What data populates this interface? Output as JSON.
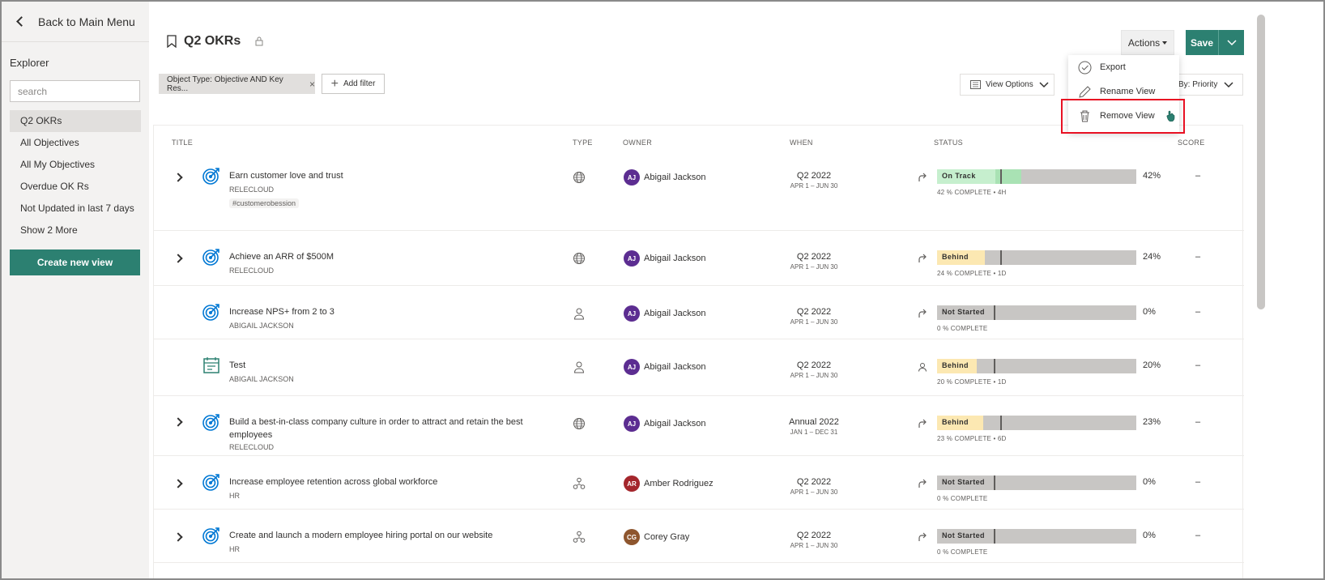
{
  "sidebar": {
    "back_label": "Back to Main Menu",
    "explorer_title": "Explorer",
    "search_placeholder": "search",
    "items": [
      {
        "label": "Q2 OKRs"
      },
      {
        "label": "All Objectives"
      },
      {
        "label": "All My Objectives"
      },
      {
        "label": "Overdue OK Rs"
      },
      {
        "label": "Not Updated in last 7 days"
      },
      {
        "label": "Show 2 More"
      }
    ],
    "create_label": "Create new view"
  },
  "header": {
    "title": "Q2 OKRs",
    "actions_label": "Actions",
    "save_label": "Save"
  },
  "filters": {
    "chip_label": "Object Type: Objective AND Key Res...",
    "add_filter_label": "Add filter",
    "view_options_label": "View Options",
    "sort_label": "By: Priority"
  },
  "menu": {
    "items": [
      {
        "label": "Export",
        "icon": "check-circle-icon"
      },
      {
        "label": "Rename View",
        "icon": "pencil-icon"
      },
      {
        "label": "Remove View",
        "icon": "trash-icon"
      }
    ]
  },
  "table": {
    "headers": {
      "title": "TITLE",
      "type": "TYPE",
      "owner": "OWNER",
      "when": "WHEN",
      "status": "STATUS",
      "score": "SCORE"
    },
    "rows": [
      {
        "name": "Earn customer love and trust",
        "sub": "RELECLOUD",
        "tag": "#customerobession",
        "type": "globe-icon",
        "initials": "AJ",
        "owner": "Abigail Jackson",
        "avatar_color": "#5c2d91",
        "when": "Q2 2022",
        "range": "APR 1 – JUN 30",
        "trend": "arrow-icon",
        "status": "On Track",
        "status_color": "#c6efce",
        "progress": 0.42,
        "pct": "42%",
        "complete": "42 % COMPLETE • 4H",
        "score": "–"
      },
      {
        "name": "Achieve an ARR of $500M",
        "sub": "RELECLOUD",
        "type": "globe-icon",
        "initials": "AJ",
        "owner": "Abigail Jackson",
        "avatar_color": "#5c2d91",
        "when": "Q2 2022",
        "range": "APR 1 – JUN 30",
        "trend": "arrow-icon",
        "status": "Behind",
        "status_color": "#fce8b2",
        "progress": 0.24,
        "pct": "24%",
        "complete": "24 % COMPLETE • 1D",
        "score": "–"
      },
      {
        "name": "Increase NPS+ from 2 to 3",
        "sub": "ABIGAIL JACKSON",
        "type": "person-icon",
        "initials": "AJ",
        "owner": "Abigail Jackson",
        "avatar_color": "#5c2d91",
        "when": "Q2 2022",
        "range": "APR 1 – JUN 30",
        "trend": "arrow-icon",
        "status": "Not Started",
        "status_color": "#c8c6c4",
        "progress": 0,
        "pct": "0%",
        "complete": "0 % COMPLETE",
        "score": "–"
      },
      {
        "name": "Test",
        "sub": "ABIGAIL JACKSON",
        "type": "person-icon",
        "initials": "AJ",
        "owner": "Abigail Jackson",
        "avatar_color": "#5c2d91",
        "when": "Q2 2022",
        "range": "APR 1 – JUN 30",
        "trend": "person-icon",
        "status": "Behind",
        "status_color": "#fce8b2",
        "progress": 0.2,
        "pct": "20%",
        "complete": "20 % COMPLETE • 1D",
        "score": "–"
      },
      {
        "name": "Build a best-in-class company culture in order to attract and retain the best employees",
        "sub": "RELECLOUD",
        "type": "globe-icon",
        "initials": "AJ",
        "owner": "Abigail Jackson",
        "avatar_color": "#5c2d91",
        "when": "Annual 2022",
        "range": "JAN 1 – DEC 31",
        "trend": "arrow-icon",
        "status": "Behind",
        "status_color": "#fce8b2",
        "progress": 0.23,
        "pct": "23%",
        "complete": "23 % COMPLETE • 6D",
        "score": "–"
      },
      {
        "name": "Increase employee retention across global workforce",
        "sub": "HR",
        "type": "team-icon",
        "initials": "AR",
        "owner": "Amber Rodriguez",
        "avatar_color": "#a4262c",
        "when": "Q2 2022",
        "range": "APR 1 – JUN 30",
        "trend": "arrow-icon",
        "status": "Not Started",
        "status_color": "#c8c6c4",
        "progress": 0,
        "pct": "0%",
        "complete": "0 % COMPLETE",
        "score": "–"
      },
      {
        "name": "Create and launch a modern employee hiring portal on our website",
        "sub": "HR",
        "type": "team-icon",
        "initials": "CG",
        "owner": "Corey Gray",
        "avatar_color": "#8e562e",
        "when": "Q2 2022",
        "range": "APR 1 – JUN 30",
        "trend": "arrow-icon",
        "status": "Not Started",
        "status_color": "#c8c6c4",
        "progress": 0,
        "pct": "0%",
        "complete": "0 % COMPLETE",
        "score": "–"
      }
    ]
  },
  "colors": {
    "accent": "#2c8071",
    "highlight": "#e81123",
    "target_icon": "#0078d4"
  }
}
